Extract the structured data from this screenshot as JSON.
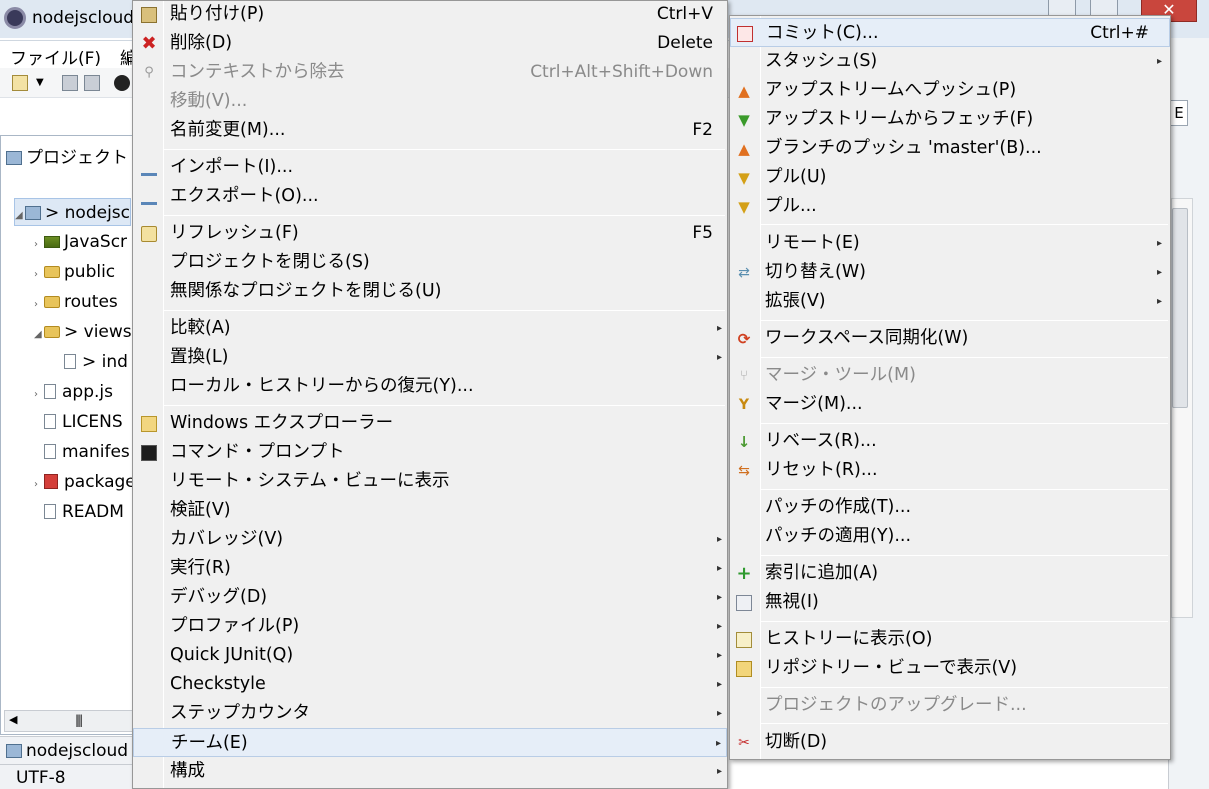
{
  "window": {
    "title": "nodejscloud",
    "close_glyph": "✕"
  },
  "menubar": {
    "file": "ファイル(F)",
    "edit": "編"
  },
  "project_explorer": {
    "title": "プロジェクト",
    "tree": [
      {
        "label": "> nodejsc",
        "icon": "project-icon",
        "twisty": "◢",
        "indent": 0
      },
      {
        "label": "JavaScr",
        "icon": "library-icon",
        "twisty": "›",
        "indent": 1
      },
      {
        "label": "public",
        "icon": "folder-icon",
        "twisty": "›",
        "indent": 1
      },
      {
        "label": "routes",
        "icon": "folder-icon",
        "twisty": "›",
        "indent": 1
      },
      {
        "label": "> views",
        "icon": "folder-icon",
        "twisty": "◢",
        "indent": 1
      },
      {
        "label": "> ind",
        "icon": "file-icon",
        "twisty": "",
        "indent": 2
      },
      {
        "label": "app.js",
        "icon": "file-icon",
        "twisty": "›",
        "indent": 1
      },
      {
        "label": "LICENS",
        "icon": "file-icon",
        "twisty": "",
        "indent": 1
      },
      {
        "label": "manifes",
        "icon": "file-icon",
        "twisty": "",
        "indent": 1
      },
      {
        "label": "package",
        "icon": "package-icon",
        "twisty": "›",
        "indent": 1
      },
      {
        "label": "READM",
        "icon": "file-icon",
        "twisty": "",
        "indent": 1
      }
    ]
  },
  "status": {
    "project": "nodejscloud",
    "encoding": "UTF-8"
  },
  "right_strip": {
    "button": "E"
  },
  "context_menu": {
    "items": [
      {
        "label": "貼り付け(P)",
        "accel": "Ctrl+V",
        "icon": "paste-icon"
      },
      {
        "label": "削除(D)",
        "accel": "Delete",
        "icon": "delete-icon"
      },
      {
        "label": "コンテキストから除去",
        "accel": "Ctrl+Alt+Shift+Down",
        "icon": "remove-context-icon",
        "disabled": true
      },
      {
        "label": "移動(V)...",
        "accel": "",
        "disabled": true
      },
      {
        "label": "名前変更(M)...",
        "accel": "F2"
      },
      {
        "label": "インポート(I)...",
        "icon": "import-icon"
      },
      {
        "label": "エクスポート(O)...",
        "icon": "export-icon"
      },
      {
        "label": "リフレッシュ(F)",
        "accel": "F5",
        "icon": "refresh-icon"
      },
      {
        "label": "プロジェクトを閉じる(S)"
      },
      {
        "label": "無関係なプロジェクトを閉じる(U)"
      },
      {
        "label": "比較(A)",
        "submenu": true
      },
      {
        "label": "置換(L)",
        "submenu": true
      },
      {
        "label": "ローカル・ヒストリーからの復元(Y)..."
      },
      {
        "label": "Windows エクスプローラー",
        "icon": "explorer-icon"
      },
      {
        "label": "コマンド・プロンプト",
        "icon": "command-prompt-icon"
      },
      {
        "label": "リモート・システム・ビューに表示"
      },
      {
        "label": "検証(V)"
      },
      {
        "label": "カバレッジ(V)",
        "submenu": true
      },
      {
        "label": "実行(R)",
        "submenu": true
      },
      {
        "label": "デバッグ(D)",
        "submenu": true
      },
      {
        "label": "プロファイル(P)",
        "submenu": true
      },
      {
        "label": "Quick JUnit(Q)",
        "submenu": true
      },
      {
        "label": "Checkstyle",
        "submenu": true
      },
      {
        "label": "ステップカウンタ",
        "submenu": true
      },
      {
        "label": "チーム(E)",
        "submenu": true,
        "highlighted": true
      },
      {
        "label": "構成",
        "submenu": true
      }
    ]
  },
  "team_menu": {
    "items": [
      {
        "label": "コミット(C)...",
        "accel": "Ctrl+#",
        "icon": "commit-icon",
        "highlighted": true
      },
      {
        "label": "スタッシュ(S)",
        "submenu": true
      },
      {
        "label": "アップストリームへプッシュ(P)",
        "icon": "push-icon"
      },
      {
        "label": "アップストリームからフェッチ(F)",
        "icon": "fetch-icon"
      },
      {
        "label": "ブランチのプッシュ 'master'(B)...",
        "icon": "push-branch-icon"
      },
      {
        "label": "プル(U)",
        "icon": "pull-icon"
      },
      {
        "label": "プル...",
        "icon": "pull-dialog-icon"
      },
      {
        "label": "リモート(E)",
        "submenu": true
      },
      {
        "label": "切り替え(W)",
        "submenu": true,
        "icon": "switch-icon"
      },
      {
        "label": "拡張(V)",
        "submenu": true
      },
      {
        "label": "ワークスペース同期化(W)",
        "icon": "synchronize-icon"
      },
      {
        "label": "マージ・ツール(M)",
        "icon": "merge-tool-icon",
        "disabled": true
      },
      {
        "label": "マージ(M)...",
        "icon": "merge-icon"
      },
      {
        "label": "リベース(R)...",
        "icon": "rebase-icon"
      },
      {
        "label": "リセット(R)...",
        "icon": "reset-icon"
      },
      {
        "label": "パッチの作成(T)..."
      },
      {
        "label": "パッチの適用(Y)..."
      },
      {
        "label": "索引に追加(A)",
        "icon": "add-to-index-icon"
      },
      {
        "label": "無視(I)",
        "icon": "ignore-icon"
      },
      {
        "label": "ヒストリーに表示(O)",
        "icon": "history-icon"
      },
      {
        "label": "リポジトリー・ビューで表示(V)",
        "icon": "repository-icon"
      },
      {
        "label": "プロジェクトのアップグレード...",
        "disabled": true
      },
      {
        "label": "切断(D)",
        "icon": "disconnect-icon"
      }
    ]
  },
  "colors": {
    "menu_bg": "#f0f0f0",
    "highlight": "#e6eef8",
    "disabled_text": "#8a8a8a",
    "close_button": "#c9463d"
  }
}
